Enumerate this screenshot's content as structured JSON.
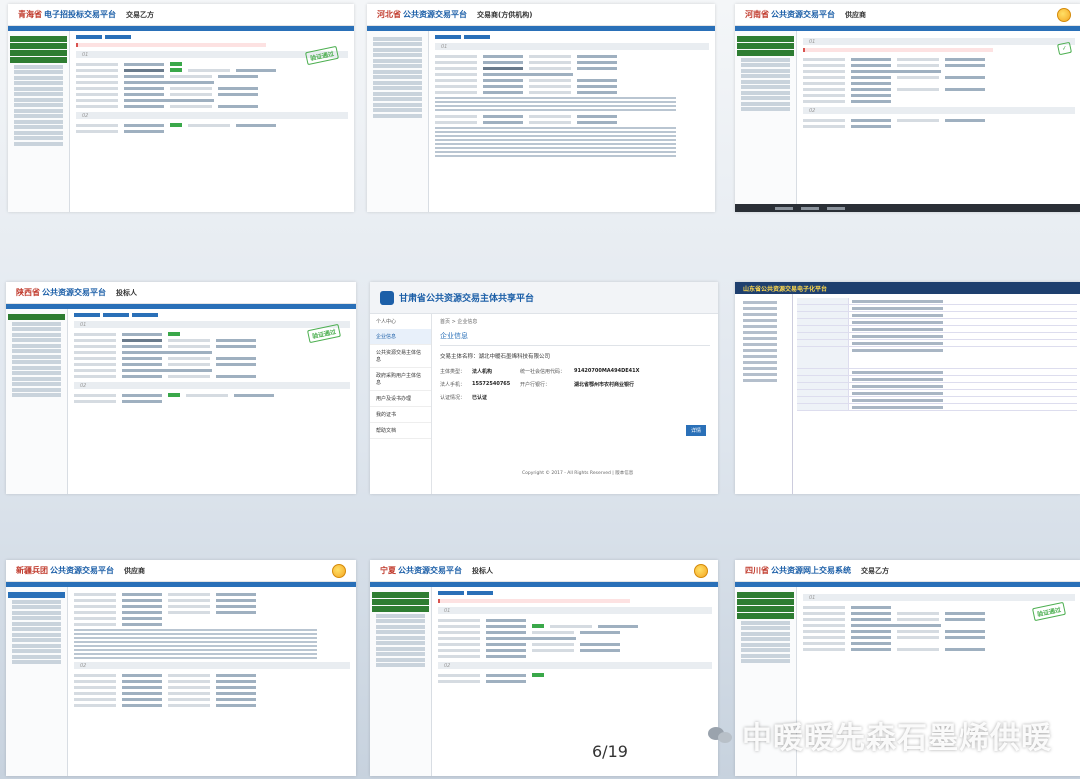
{
  "frames": {
    "qinghai": {
      "province": "青海省",
      "platform": "电子招投标交易平台",
      "role": "交易乙方",
      "stamp": "验证通过"
    },
    "hebei": {
      "province": "河北省",
      "platform": "公共资源交易平台",
      "role": "交易商(方供机构)"
    },
    "henan": {
      "province": "河南省",
      "platform": "公共资源交易平台",
      "role": "供应商"
    },
    "shaanxi": {
      "province": "陕西省",
      "platform": "公共资源交易平台",
      "role": "投标人",
      "stamp": "验证通过"
    },
    "gansu": {
      "title": "甘肃省公共资源交易主体共享平台",
      "user": "个人中心",
      "menu": [
        "企业信息",
        "公共资源交易主体信息",
        "政府采购用户主体信息",
        "用户及设书办理",
        "我的证书",
        "帮助文档"
      ],
      "breadcrumb": "首页 > 企业信息",
      "heading": "企业信息",
      "entity_label": "交易主体名称：",
      "entity_name": "湖北中暖石墨烯科技有限公司",
      "fields": [
        {
          "k": "主体类型：",
          "v": "法人机构",
          "k2": "统一社会信用代码：",
          "v2": "91420700MA494DE41X"
        },
        {
          "k": "法人手机：",
          "v": "15572540765",
          "k2": "开户行银行：",
          "v2": "湖北省鄂州市农村商业银行"
        },
        {
          "k": "认证情况：",
          "v": "已认证",
          "k2": "",
          "v2": ""
        }
      ],
      "button": "详情",
      "footer": "Copyright © 2017 - All Rights Reserved | 版本信息"
    },
    "shandong": {
      "title": "山东省公共资源交易电子化平台"
    },
    "xinjiang": {
      "province": "新疆兵团",
      "platform": "公共资源交易平台",
      "role": "供应商"
    },
    "ningxia": {
      "province": "宁夏",
      "platform": "公共资源交易平台",
      "role": "投标人"
    },
    "sichuan": {
      "province": "四川省",
      "platform": "公共资源网上交易系统",
      "role": "交易乙方",
      "stamp": "验证通过"
    }
  },
  "page_number": "6/19",
  "watermark": "中暖暖先森石墨烯供暖"
}
